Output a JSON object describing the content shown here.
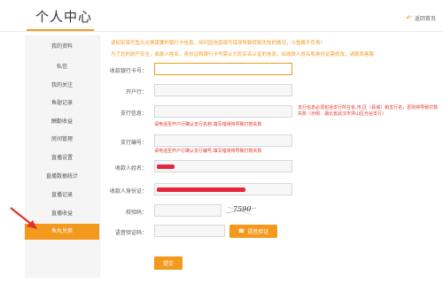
{
  "header": {
    "title": "个人中心",
    "back_label": "返回首页"
  },
  "sidebar": {
    "items": [
      {
        "label": "我的资料"
      },
      {
        "label": "私信"
      },
      {
        "label": "我的关注"
      },
      {
        "label": "鱼翅记录"
      },
      {
        "label": "酬勤收益"
      },
      {
        "label": "房间管理"
      },
      {
        "label": "直播设置"
      },
      {
        "label": "直播数据统计"
      },
      {
        "label": "直播记录"
      },
      {
        "label": "直播收益"
      },
      {
        "label": "鱼丸兑换"
      }
    ],
    "active_index": 10
  },
  "notice": {
    "line1": "请如实填写鱼丸兑换需要的银行卡信息，如何因信息填写错误导致转账失败的情况，斗鱼概不负责！",
    "line2": "为了您的财产安全，收款人姓名，身份证和银行卡号需认为您实名认证的信息，如收款人姓名和身份证需修改，请联系客服"
  },
  "form": {
    "card_label": "收款银行卡号：",
    "card_value": "",
    "bank_label": "开户行：",
    "bank_value": "",
    "branch_label": "支行信息：",
    "branch_value": "",
    "branch_hint_right": "支行信息必须包括支行所在省,市,区（县城）和支行名，否则将导致打款失败（示例：湖北省武汉市洪山区光谷支行）",
    "branch_hint_below": "请电话至开户行确认支行名称,填写错误将导致打款失败",
    "code_label": "支行编号：",
    "code_value": "",
    "code_hint": "请电话至开户行确认支行编号,填写错误将导致打款失败",
    "name_label": "收款人姓名：",
    "id_label": "收款人身份证：",
    "captcha_label": "校验码：",
    "captcha_text": "7590",
    "sms_label": "语音验证码：",
    "sms_button_label": "语音验证",
    "submit_label": "提交"
  },
  "colors": {
    "accent": "#f39a1e",
    "error": "#e0332b",
    "redaction": "#e8243a"
  }
}
